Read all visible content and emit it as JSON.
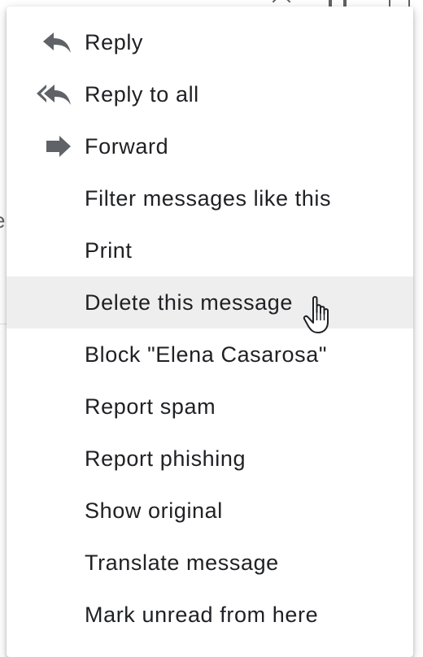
{
  "menu": {
    "items": [
      {
        "label": "Reply",
        "icon": "reply-icon"
      },
      {
        "label": "Reply to all",
        "icon": "reply-all-icon"
      },
      {
        "label": "Forward",
        "icon": "forward-icon"
      },
      {
        "label": "Filter messages like this"
      },
      {
        "label": "Print"
      },
      {
        "label": "Delete this message",
        "hovered": true
      },
      {
        "label": "Block \"Elena Casarosa\""
      },
      {
        "label": "Report spam"
      },
      {
        "label": "Report phishing"
      },
      {
        "label": "Show original"
      },
      {
        "label": "Translate message"
      },
      {
        "label": "Mark unread from here"
      }
    ]
  },
  "background": {
    "partial_text": "e"
  },
  "colors": {
    "icon": "#5f6368",
    "text": "#202124",
    "hover_background": "#eeeeee"
  },
  "cursor": "hand-pointer-icon"
}
